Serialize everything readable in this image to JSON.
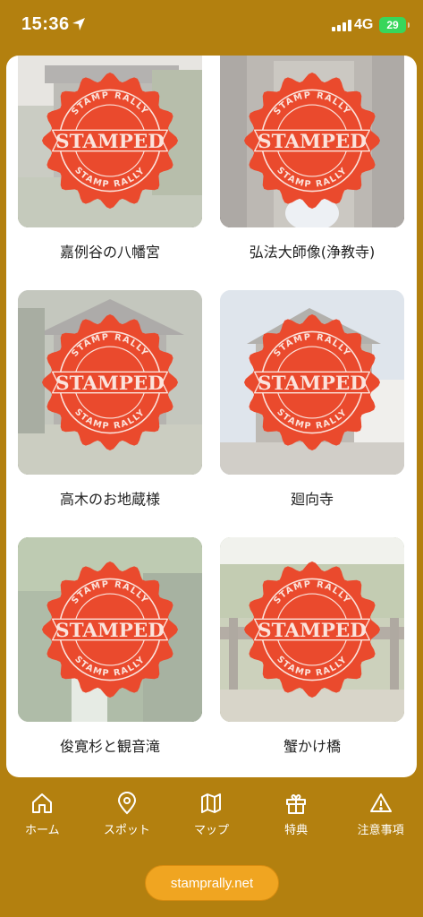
{
  "status_bar": {
    "time": "15:36",
    "network": "4G",
    "battery": "29",
    "location_icon": "location-arrow-icon",
    "signal_icon": "signal-bars-icon"
  },
  "stamp_badge": {
    "top_text": "STAMP RALLY",
    "main_text": "STAMPED",
    "bottom_text": "STAMP RALLY",
    "color": "#ea4a2d"
  },
  "spots": [
    {
      "name": "嘉例谷の八幡宮",
      "photo": "shrine-photo"
    },
    {
      "name": "弘法大師像(浄教寺)",
      "photo": "statue-photo"
    },
    {
      "name": "高木のお地蔵様",
      "photo": "jizo-photo"
    },
    {
      "name": "廻向寺",
      "photo": "temple-photo"
    },
    {
      "name": "俊寛杉と観音滝",
      "photo": "waterfall-photo"
    },
    {
      "name": "蟹かけ橋",
      "photo": "bridge-photo"
    }
  ],
  "nav": [
    {
      "label": "ホーム",
      "icon": "home-icon"
    },
    {
      "label": "スポット",
      "icon": "map-pin-icon"
    },
    {
      "label": "マップ",
      "icon": "map-icon"
    },
    {
      "label": "特典",
      "icon": "gift-icon"
    },
    {
      "label": "注意事項",
      "icon": "warning-icon"
    }
  ],
  "footer": {
    "link_label": "stamprally.net"
  },
  "colors": {
    "background": "#b3800f",
    "accent": "#f0a521",
    "stamp": "#ea4a2d"
  }
}
